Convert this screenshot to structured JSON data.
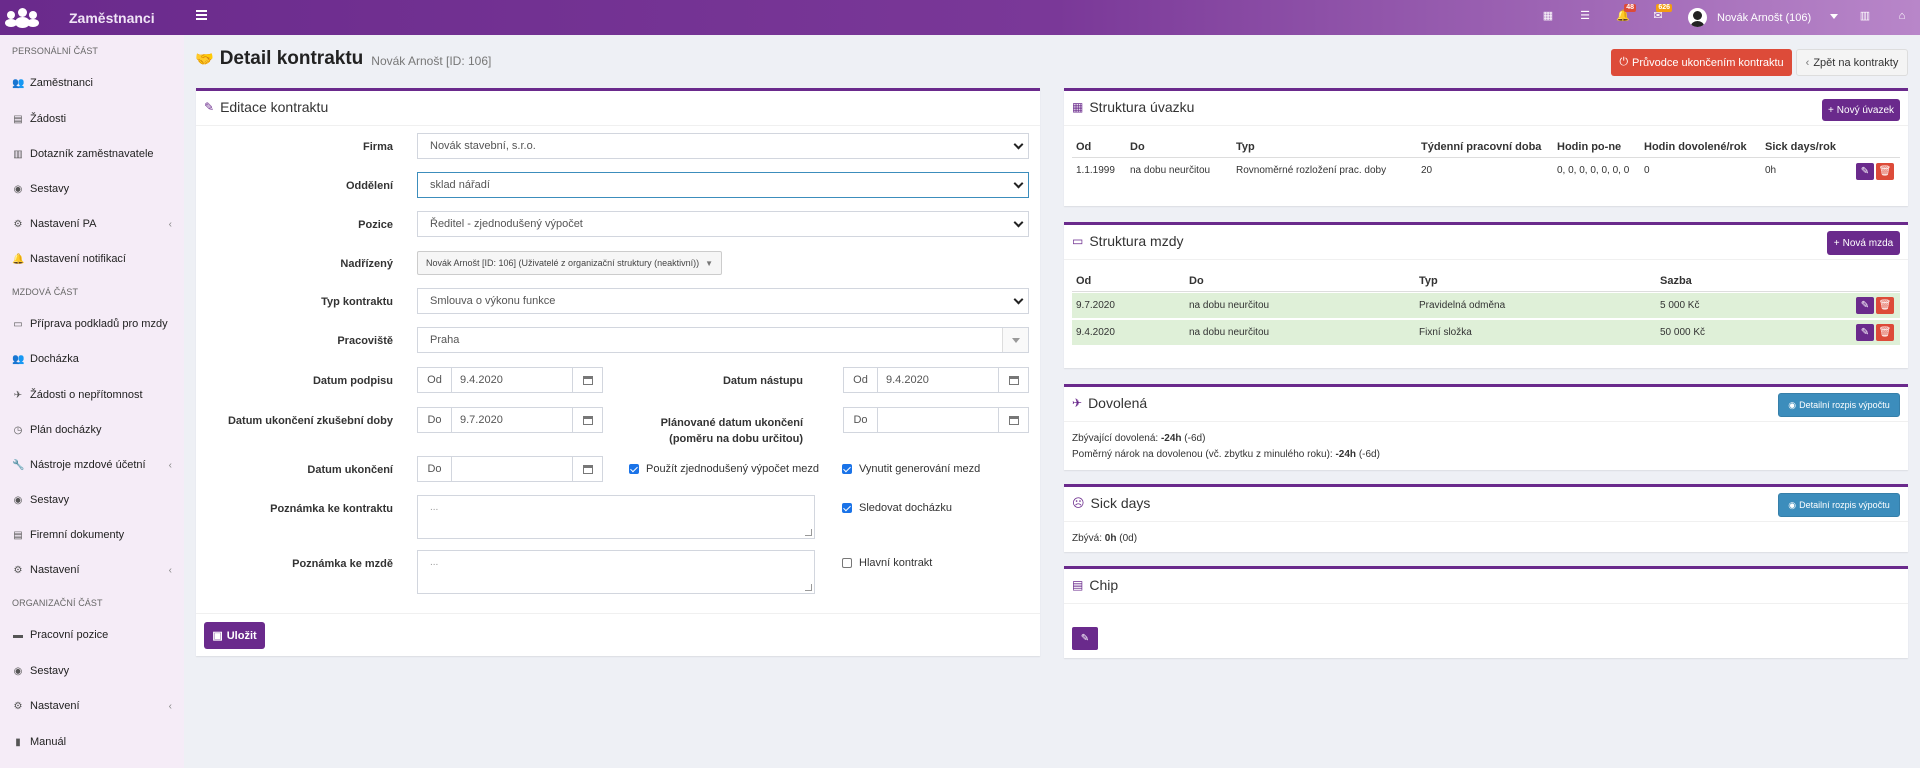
{
  "app": {
    "title": "Zaměstnanci",
    "user": "Novák Arnošt (106)",
    "badges": {
      "notifications": "48",
      "tasks": "626"
    }
  },
  "sidebar": {
    "sections": [
      {
        "title": "PERSONÁLNÍ ČÁST",
        "items": [
          "Zaměstnanci",
          "Žádosti",
          "Dotazník zaměstnavatele",
          "Sestavy",
          "Nastavení PA",
          "Nastavení notifikací"
        ]
      },
      {
        "title": "MZDOVÁ ČÁST",
        "items": [
          "Příprava podkladů pro mzdy",
          "Docházka",
          "Žádosti o nepřítomnost",
          "Plán docházky",
          "Nástroje mzdové účetní",
          "Sestavy",
          "Firemní dokumenty",
          "Nastavení"
        ]
      },
      {
        "title": "ORGANIZAČNÍ ČÁST",
        "items": [
          "Pracovní pozice",
          "Sestavy",
          "Nastavení",
          "Manuál"
        ]
      }
    ]
  },
  "header": {
    "title": "Detail kontraktu",
    "subtitle": "Novák Arnošt [ID: 106]",
    "btn_end": "Průvodce ukončením kontraktu",
    "btn_back": "Zpět na kontrakty"
  },
  "edit": {
    "title": "Editace kontraktu",
    "labels": {
      "firma": "Firma",
      "oddeleni": "Oddělení",
      "pozice": "Pozice",
      "nadrizeny": "Nadřízený",
      "typ": "Typ kontraktu",
      "pracoviste": "Pracoviště",
      "podpis": "Datum podpisu",
      "nastup": "Datum nástupu",
      "zkusebni": "Datum ukončení zkušební doby",
      "planovane": "Plánované datum ukončení (poměru na dobu určitou)",
      "ukonceni": "Datum ukončení",
      "pozn_kontrakt": "Poznámka ke kontraktu",
      "pozn_mzda": "Poznámka ke mzdě"
    },
    "values": {
      "firma": "Novák stavební, s.r.o.",
      "oddeleni": "sklad nářadí",
      "pozice": "Ředitel - zjednodušený výpočet",
      "nadrizeny": "Novák Arnošt [ID: 106] (Uživatelé z organizační struktury (neaktivní))",
      "typ": "Smlouva o výkonu funkce",
      "pracoviste": "Praha",
      "podpis": "9.4.2020",
      "nastup": "9.4.2020",
      "zkusebni": "9.7.2020",
      "planovane": "",
      "ukonceni": ""
    },
    "prefix_od": "Od",
    "prefix_do": "Do",
    "placeholder": "...",
    "checks": {
      "zjednoduseny": "Použít zjednodušený výpočet mezd",
      "vynutit": "Vynutit generování mezd",
      "dochazka": "Sledovat docházku",
      "hlavni": "Hlavní kontrakt"
    },
    "save": "Uložit"
  },
  "uvazek": {
    "title": "Struktura úvazku",
    "btn": "Nový úvazek",
    "headers": [
      "Od",
      "Do",
      "Typ",
      "Týdenní pracovní doba",
      "Hodin po-ne",
      "Hodin dovolené/rok",
      "Sick days/rok"
    ],
    "rows": [
      [
        "1.1.1999",
        "na dobu neurčitou",
        "Rovnoměrné rozložení prac. doby",
        "20",
        "0, 0, 0, 0, 0, 0, 0",
        "0",
        "0h"
      ]
    ]
  },
  "mzda": {
    "title": "Struktura mzdy",
    "btn": "Nová mzda",
    "headers": [
      "Od",
      "Do",
      "Typ",
      "Sazba"
    ],
    "rows": [
      [
        "9.7.2020",
        "na dobu neurčitou",
        "Pravidelná odměna",
        "5 000 Kč"
      ],
      [
        "9.4.2020",
        "na dobu neurčitou",
        "Fixní složka",
        "50 000 Kč"
      ]
    ]
  },
  "dovolena": {
    "title": "Dovolená",
    "btn": "Detailní rozpis výpočtu",
    "line1_label": "Zbývající dovolená:",
    "line1_value": "-24h",
    "line1_extra": "(-6d)",
    "line2_label": "Poměrný nárok na dovolenou (vč. zbytku z minulého roku):",
    "line2_value": "-24h",
    "line2_extra": "(-6d)"
  },
  "sick": {
    "title": "Sick days",
    "btn": "Detailní rozpis výpočtu",
    "label": "Zbývá:",
    "value": "0h",
    "extra": "(0d)"
  },
  "chip": {
    "title": "Chip"
  },
  "colors": {
    "brand": "#6a2a8c",
    "danger": "#dd4b39",
    "info": "#3c8dbc",
    "success_row": "#dff0d8"
  }
}
